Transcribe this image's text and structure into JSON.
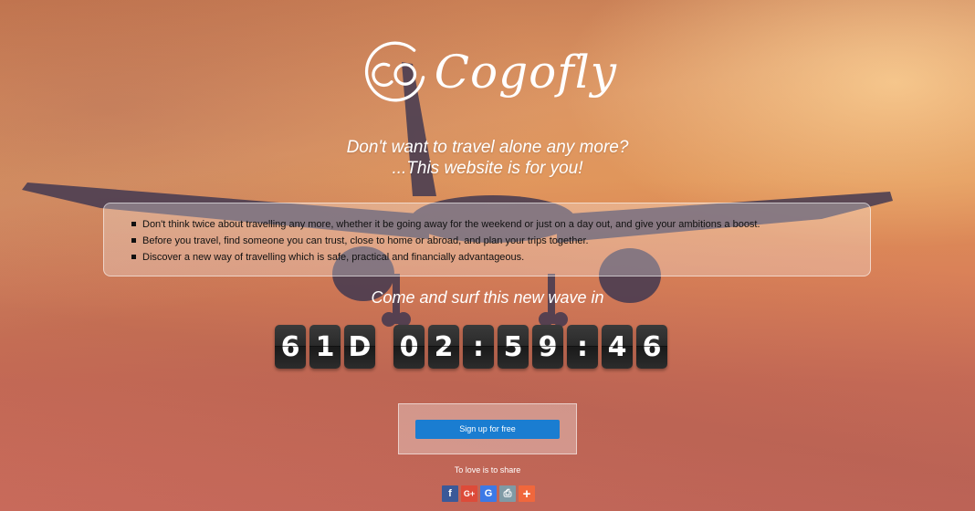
{
  "brand": {
    "name": "Cogofly",
    "logo_icon": "cogofly-logo-icon"
  },
  "tagline": {
    "line1": "Don't want to travel alone any more?",
    "line2": "...This website is for you!"
  },
  "features": [
    {
      "text": "Don't think twice about travelling any more, whether it be going away for the weekend or just on a day out, and give your ambitions a boost."
    },
    {
      "text": "Before you travel, find someone you can trust, close to home or abroad, and plan your trips together."
    },
    {
      "text": "Discover a new way of travelling which is safe, practical and financially advantageous."
    }
  ],
  "countdown": {
    "heading": "Come and surf this new wave in",
    "days": [
      "6",
      "1",
      "D"
    ],
    "hours": [
      "0",
      "2"
    ],
    "sep1": ":",
    "minutes": [
      "5",
      "9"
    ],
    "sep2": ":",
    "seconds": [
      "4",
      "6"
    ]
  },
  "signup": {
    "label": "Sign up for free",
    "color": "#1a7dd1"
  },
  "share": {
    "label": "To love is to share",
    "icons": [
      {
        "name": "facebook-icon",
        "glyph": "f",
        "color": "#3b5998"
      },
      {
        "name": "google-plus-icon",
        "glyph": "G+",
        "color": "#dd4b39"
      },
      {
        "name": "google-icon",
        "glyph": "G",
        "color": "#3c79e6"
      },
      {
        "name": "print-icon",
        "glyph": "⎙",
        "color": "#7f9aa5"
      },
      {
        "name": "more-share-icon",
        "glyph": "+",
        "color": "#f0673c"
      }
    ]
  }
}
